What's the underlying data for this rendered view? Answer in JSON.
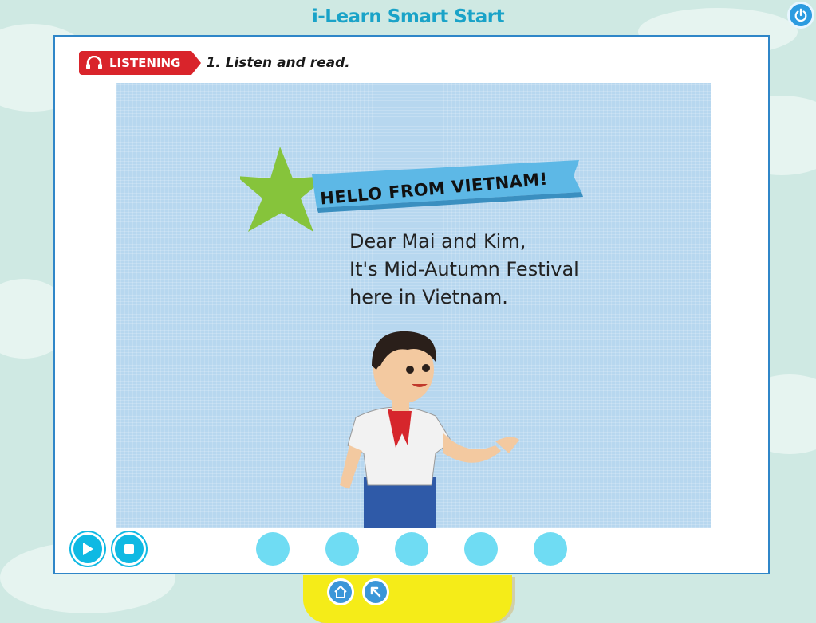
{
  "app": {
    "title": "i-Learn Smart Start"
  },
  "header": {
    "tag_label": "LISTENING",
    "instruction": "1. Listen and read."
  },
  "scene": {
    "banner": "HELLO FROM VIETNAM!",
    "letter_lines": [
      "Dear Mai and Kim,",
      "It's Mid-Autumn Festival",
      "here in Vietnam."
    ]
  },
  "controls": {
    "buttons": [
      {
        "name": "play-button",
        "icon": "play-icon"
      },
      {
        "name": "stop-button",
        "icon": "stop-icon"
      }
    ],
    "page_dots": 5
  },
  "nav": {
    "buttons": [
      {
        "name": "home-button",
        "icon": "home-icon"
      },
      {
        "name": "back-button",
        "icon": "back-arrow-icon"
      }
    ]
  },
  "colors": {
    "title": "#1aa3c8",
    "tag": "#d9242b",
    "panel_border": "#2f86c8",
    "control": "#0fb9e3",
    "dot": "#6fdcf3",
    "bottom_bar": "#f5ec18"
  }
}
